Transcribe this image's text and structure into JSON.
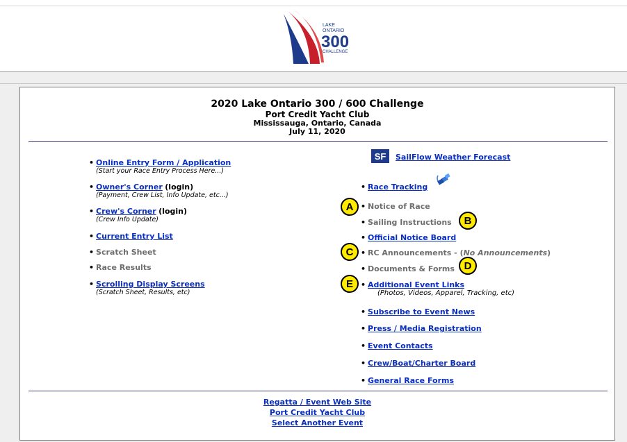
{
  "header": {
    "logo_line1": "LAKE",
    "logo_line2": "ONTARIO",
    "logo_number": "300",
    "logo_line3": "CHALLENGE"
  },
  "event": {
    "title": "2020 Lake Ontario 300 / 600 Challenge",
    "club": "Port Credit Yacht Club",
    "location": "Mississauga, Ontario, Canada",
    "date": "July 11, 2020"
  },
  "left_links": {
    "entry_form": "Online Entry Form / Application",
    "entry_form_note": "(Start your Race Entry Process Here...)",
    "owners_corner": "Owner's Corner",
    "owners_login": "(login)",
    "owners_note": "(Payment, Crew List, Info Update, etc...)",
    "crews_corner": "Crew's Corner",
    "crews_login": "(login)",
    "crews_note": "(Crew Info Update)",
    "current_entry": "Current Entry List",
    "scratch_sheet": "Scratch Sheet",
    "race_results": "Race Results",
    "scrolling": "Scrolling Display Screens",
    "scrolling_note": "(Scratch Sheet, Results, etc)"
  },
  "right_links": {
    "sf_icon": "SF",
    "sailflow": "SailFlow Weather Forecast",
    "race_tracking": "Race Tracking",
    "notice_of_race": "Notice of Race",
    "sailing_instructions": "Sailing Instructions",
    "official_notice": "Official Notice Board",
    "rc_announcements": "RC Announcements - (",
    "rc_none": "No Announcements",
    "rc_close": ")",
    "documents": "Documents & Forms",
    "additional_links": "Additional Event Links",
    "additional_note": "(Photos, Videos, Apparel, Tracking, etc)",
    "subscribe": "Subscribe to Event News",
    "press": "Press / Media Registration",
    "contacts": "Event Contacts",
    "crew_board": "Crew/Boat/Charter Board",
    "general_forms": "General Race Forms"
  },
  "footer": {
    "regatta_site": "Regatta / Event Web Site",
    "club_link": "Port Credit Yacht Club",
    "select_event": "Select Another Event"
  },
  "badges": {
    "a": "A",
    "b": "B",
    "c": "C",
    "d": "D",
    "e": "E"
  },
  "colors": {
    "link": "#0a2fbf",
    "badge": "#ffea00",
    "logo_red": "#c8202a",
    "logo_blue": "#1e3a8a"
  }
}
